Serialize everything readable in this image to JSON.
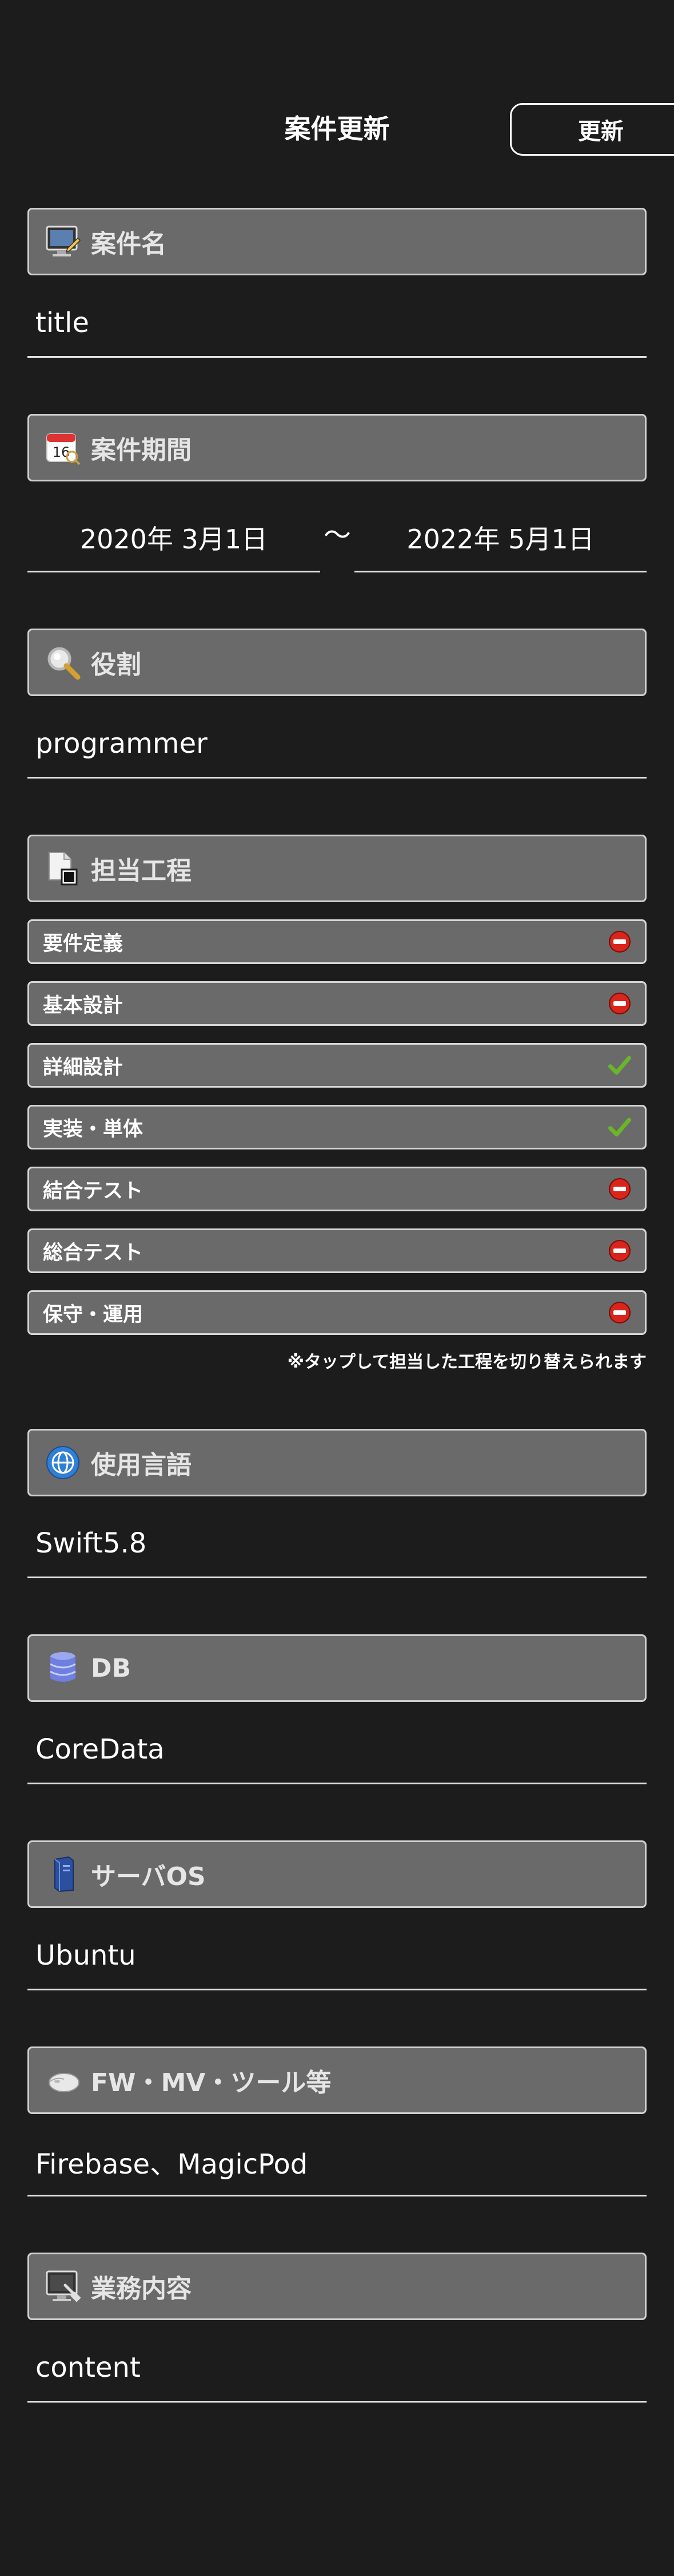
{
  "header": {
    "title": "案件更新",
    "update_label": "更新"
  },
  "sections": {
    "title": {
      "label": "案件名",
      "value": "title"
    },
    "period": {
      "label": "案件期間",
      "start": "2020年 3月1日",
      "end": "2022年 5月1日",
      "separator": "〜"
    },
    "role": {
      "label": "役割",
      "value": "programmer"
    },
    "process": {
      "label": "担当工程",
      "items": [
        {
          "label": "要件定義",
          "status": "off"
        },
        {
          "label": "基本設計",
          "status": "off"
        },
        {
          "label": "詳細設計",
          "status": "on"
        },
        {
          "label": "実装・単体",
          "status": "on"
        },
        {
          "label": "結合テスト",
          "status": "off"
        },
        {
          "label": "総合テスト",
          "status": "off"
        },
        {
          "label": "保守・運用",
          "status": "off"
        }
      ],
      "note": "※タップして担当した工程を切り替えられます"
    },
    "language": {
      "label": "使用言語",
      "value": "Swift5.8"
    },
    "db": {
      "label": "DB",
      "value": "CoreData"
    },
    "server_os": {
      "label": "サーバOS",
      "value": "Ubuntu"
    },
    "tools": {
      "label": "FW・MV・ツール等",
      "value": "Firebase、MagicPod"
    },
    "content": {
      "label": "業務内容",
      "value": "content"
    }
  },
  "colors": {
    "background": "#1c1c1c",
    "section_fill": "#6a6a6a",
    "on": "#6ab52a",
    "off": "#d9251c"
  }
}
